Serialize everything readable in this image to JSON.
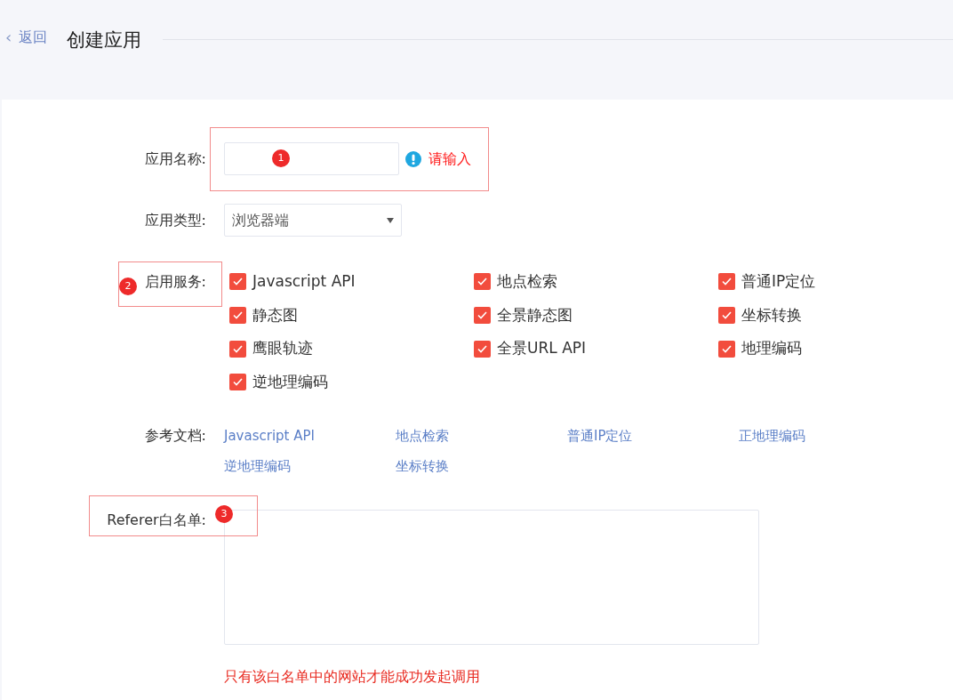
{
  "header": {
    "back": "返回",
    "back_icon": "‹",
    "title": "创建应用"
  },
  "form": {
    "name": {
      "label": "应用名称:",
      "error": "请输入",
      "annotation": "1"
    },
    "type": {
      "label": "应用类型:",
      "value": "浏览器端"
    },
    "services": {
      "label": "启用服务:",
      "annotation": "2",
      "items": [
        {
          "label": "Javascript API",
          "checked": true
        },
        {
          "label": "地点检索",
          "checked": true
        },
        {
          "label": "普通IP定位",
          "checked": true
        },
        {
          "label": "静态图",
          "checked": true
        },
        {
          "label": "全景静态图",
          "checked": true
        },
        {
          "label": "坐标转换",
          "checked": true
        },
        {
          "label": "鹰眼轨迹",
          "checked": true
        },
        {
          "label": "全景URL API",
          "checked": true
        },
        {
          "label": "地理编码",
          "checked": true
        },
        {
          "label": "逆地理编码",
          "checked": true
        }
      ]
    },
    "docs": {
      "label": "参考文档:",
      "links": [
        "Javascript API",
        "地点检索",
        "普通IP定位",
        "正地理编码",
        "逆地理编码",
        "坐标转换"
      ]
    },
    "referer": {
      "label": "Referer白名单:",
      "hint": "只有该白名单中的网站才能成功发起调用",
      "annotation": "3"
    }
  }
}
